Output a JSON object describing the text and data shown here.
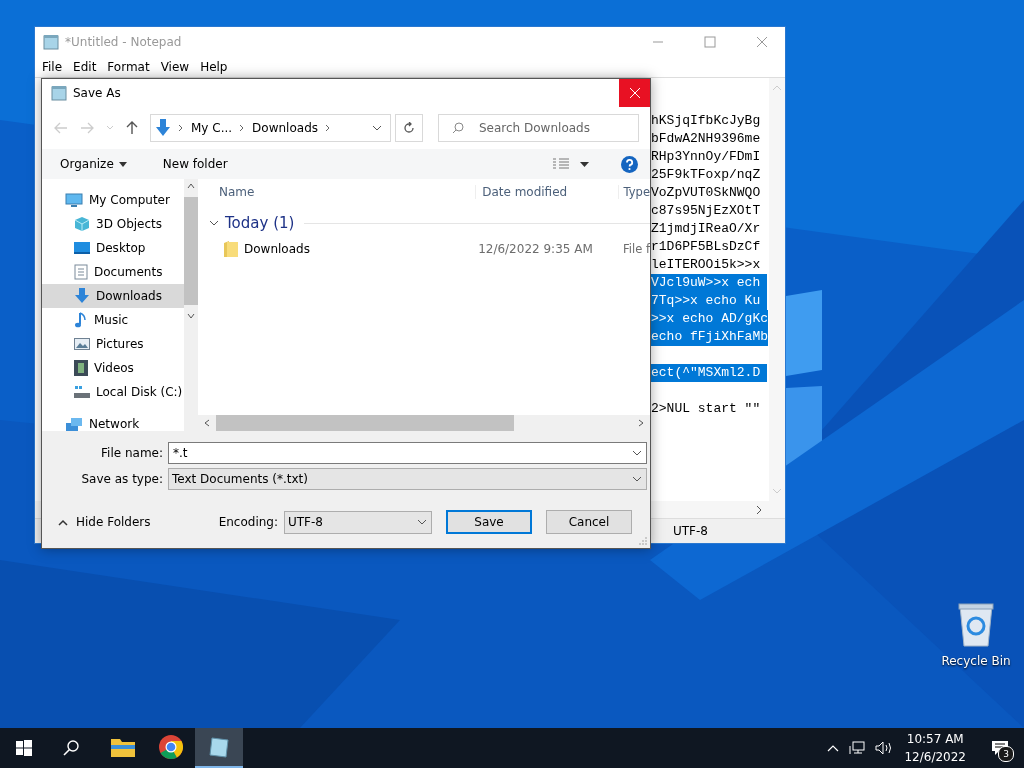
{
  "desktop": {
    "icons": [
      {
        "label": "Recycle Bin",
        "kind": "recycle-bin"
      }
    ]
  },
  "notepad": {
    "title": "*Untitled - Notepad",
    "active": false,
    "menu": [
      "File",
      "Edit",
      "Format",
      "View",
      "Help"
    ],
    "lines": [
      {
        "kind": "text",
        "text": "hKSjqIfbKcJyBg",
        "selected": false
      },
      {
        "kind": "text",
        "text": "bFdwA2NH9396me",
        "selected": false
      },
      {
        "kind": "text",
        "text": "RHp3YnnOy/FDmI",
        "selected": false
      },
      {
        "kind": "text",
        "text": "25F9kTFoxp/nqZ",
        "selected": false
      },
      {
        "kind": "text",
        "text": "VoZpVUT0SkNWQO",
        "selected": false
      },
      {
        "kind": "text",
        "text": "c87s95NjEzXOtT",
        "selected": false
      },
      {
        "kind": "text",
        "text": "Z1jmdjIReaO/Xr",
        "selected": false
      },
      {
        "kind": "text",
        "text": "r1D6PF5BLsDzCf",
        "selected": false
      },
      {
        "kind": "text",
        "text": "leITEROOi5k>>x",
        "selected": false
      },
      {
        "kind": "text",
        "text": "VJcl9uW>>x ech",
        "selected": true
      },
      {
        "kind": "text",
        "text": "7Tq>>x echo Ku",
        "selected": true
      },
      {
        "kind": "text",
        "text": ">>x echo AD/gKc",
        "selected": true
      },
      {
        "kind": "text",
        "text": "echo fFjiXhFaMb",
        "selected": true
      },
      {
        "kind": "blank"
      },
      {
        "kind": "text",
        "text": "ect(^\"MSXml2.D",
        "selected": true
      },
      {
        "kind": "blank"
      },
      {
        "kind": "text",
        "text": "2>NUL start \"\"",
        "selected": false
      }
    ],
    "status_bar": {
      "encoding": "UTF-8"
    }
  },
  "save_dialog": {
    "title": "Save As",
    "address": {
      "crumbs": [
        "My C...",
        "Downloads"
      ]
    },
    "search": {
      "placeholder": "Search Downloads"
    },
    "toolbar": {
      "organize": "Organize",
      "new_folder": "New folder"
    },
    "sidebar": {
      "items": [
        {
          "label": "My Computer",
          "kind": "computer",
          "selected": false,
          "children": [
            {
              "label": "3D Objects",
              "kind": "objects",
              "selected": false
            },
            {
              "label": "Desktop",
              "kind": "desktop",
              "selected": false
            },
            {
              "label": "Documents",
              "kind": "documents",
              "selected": false
            },
            {
              "label": "Downloads",
              "kind": "downloads",
              "selected": true
            },
            {
              "label": "Music",
              "kind": "music",
              "selected": false
            },
            {
              "label": "Pictures",
              "kind": "pictures",
              "selected": false
            },
            {
              "label": "Videos",
              "kind": "videos",
              "selected": false
            },
            {
              "label": "Local Disk (C:)",
              "kind": "disk",
              "selected": false
            }
          ]
        },
        {
          "label": "Network",
          "kind": "network",
          "selected": false
        }
      ]
    },
    "columns": [
      "Name",
      "Date modified",
      "Type"
    ],
    "groups": [
      {
        "label": "Today (1)",
        "expanded": true,
        "rows": [
          {
            "name": "Downloads",
            "date": "12/6/2022 9:35 AM",
            "type": "File f"
          }
        ]
      }
    ],
    "file_name": {
      "label": "File name:",
      "value": "*.t"
    },
    "save_type": {
      "label": "Save as type:",
      "value": "Text Documents (*.txt)"
    },
    "hide_folders": "Hide Folders",
    "encoding": {
      "label": "Encoding:",
      "value": "UTF-8"
    },
    "buttons": [
      {
        "label": "Save",
        "kind": "default"
      },
      {
        "label": "Cancel",
        "kind": "normal"
      }
    ]
  },
  "taskbar": {
    "apps": [
      {
        "kind": "explorer",
        "active": false
      },
      {
        "kind": "chrome",
        "active": false
      },
      {
        "kind": "notepad",
        "active": true
      }
    ],
    "clock": {
      "time": "10:57 AM",
      "date": "12/6/2022"
    },
    "notifications": {
      "count": "3"
    }
  }
}
